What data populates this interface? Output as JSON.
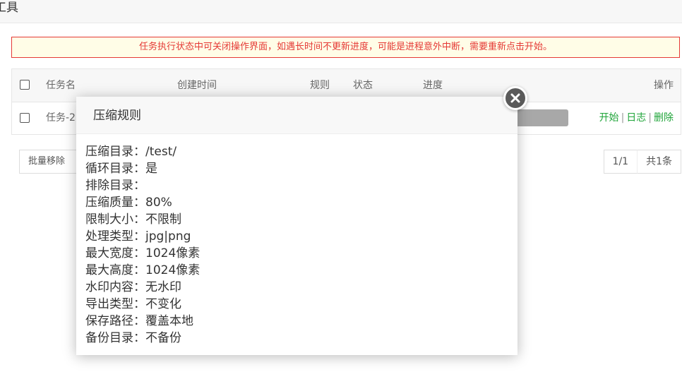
{
  "header": {
    "title": "工具"
  },
  "alert": {
    "text": "任务执行状态中可关闭操作界面，如遇长时间不更新进度，可能是进程意外中断，需要重新点击开始。"
  },
  "table": {
    "columns": {
      "name": "任务名",
      "created": "创建时间",
      "rule": "规则",
      "status": "状态",
      "progress": "进度",
      "actions": "操作"
    },
    "rows": [
      {
        "name": "任务-2",
        "progress": 0,
        "actions": {
          "start": "开始",
          "log": "日志",
          "delete": "删除",
          "separator": "|"
        }
      }
    ]
  },
  "bulk_remove": {
    "label": "批量移除"
  },
  "pager": {
    "current": "1/1",
    "total": "共1条"
  },
  "modal": {
    "title": "压缩规则",
    "rows": [
      {
        "label": "压缩目录：",
        "value": "/test/"
      },
      {
        "label": "循环目录：",
        "value": "是"
      },
      {
        "label": "排除目录：",
        "value": ""
      },
      {
        "label": "压缩质量：",
        "value": "80%"
      },
      {
        "label": "限制大小：",
        "value": "不限制"
      },
      {
        "label": "处理类型：",
        "value": "jpg|png"
      },
      {
        "label": "最大宽度：",
        "value": "1024像素"
      },
      {
        "label": "最大高度：",
        "value": "1024像素"
      },
      {
        "label": "水印内容：",
        "value": "无水印"
      },
      {
        "label": "导出类型：",
        "value": "不变化"
      },
      {
        "label": "保存路径：",
        "value": "覆盖本地"
      },
      {
        "label": "备份目录：",
        "value": "不备份"
      }
    ]
  },
  "colors": {
    "accent_green": "#20a53a",
    "alert_red": "#e53935",
    "alert_bg": "#fffde7"
  },
  "icons": {
    "close": "close-icon"
  }
}
